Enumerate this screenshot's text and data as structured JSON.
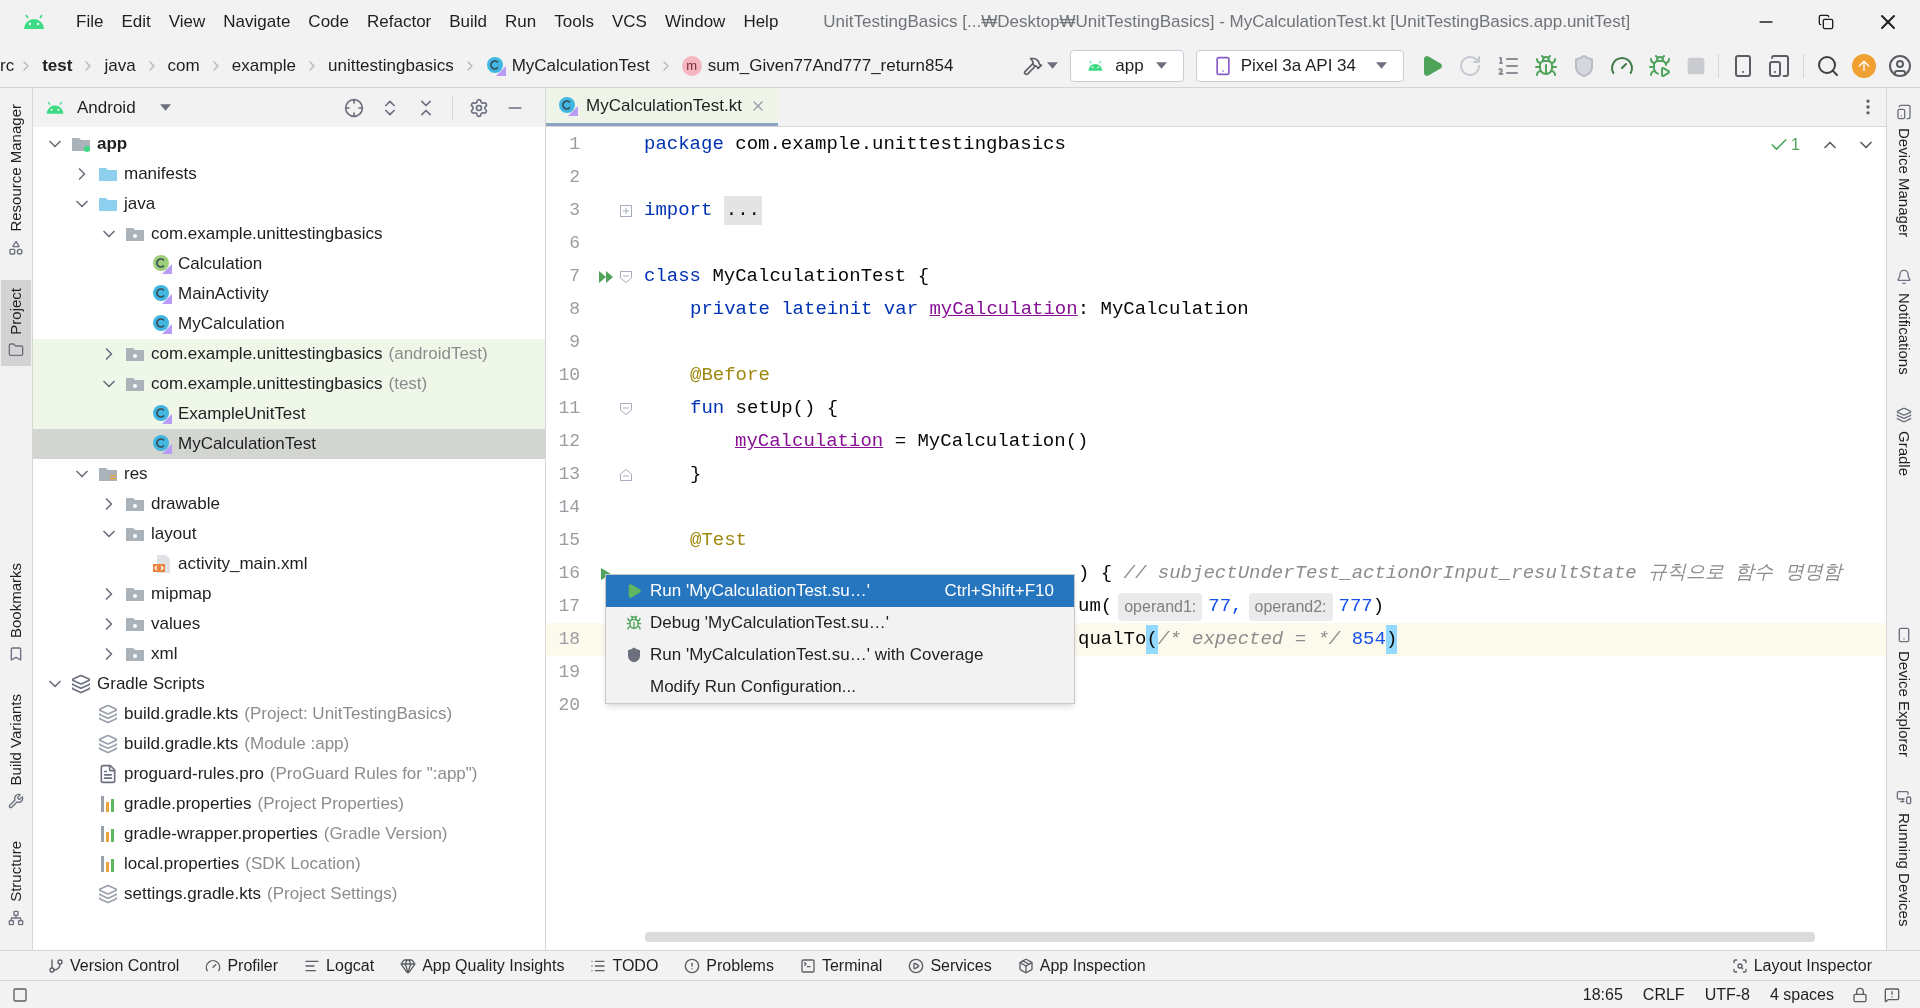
{
  "title_bar": {
    "menu": [
      "File",
      "Edit",
      "View",
      "Navigate",
      "Code",
      "Refactor",
      "Build",
      "Run",
      "Tools",
      "VCS",
      "Window",
      "Help"
    ],
    "title": "UnitTestingBasics [...₩Desktop₩UnitTestingBasics] - MyCalculationTest.kt [UnitTestingBasics.app.unitTest]"
  },
  "navigation_bar": {
    "breadcrumbs": [
      {
        "label": "rc",
        "kind": "plain"
      },
      {
        "label": "test",
        "kind": "bold"
      },
      {
        "label": "java",
        "kind": "plain"
      },
      {
        "label": "com",
        "kind": "plain"
      },
      {
        "label": "example",
        "kind": "plain"
      },
      {
        "label": "unittestingbasics",
        "kind": "plain"
      },
      {
        "label": "MyCalculationTest",
        "kind": "class"
      },
      {
        "label": "sum_Given77And777_return854",
        "kind": "method",
        "badge": "m"
      }
    ],
    "run_configuration": "app",
    "device": "Pixel 3a API 34",
    "actions": [
      {
        "disabled": false
      },
      {
        "disabled": true
      },
      {
        "disabled": false
      },
      {
        "disabled": false
      },
      {
        "disabled": true
      },
      {
        "disabled": false
      },
      {
        "disabled": false
      },
      {
        "disabled": true
      }
    ]
  },
  "left_tool_windows": [
    {
      "label": "Resource Manager",
      "kind": "top",
      "selected": false
    },
    {
      "label": "Project",
      "kind": "top",
      "selected": true
    },
    {
      "label": "Bookmarks",
      "kind": "bottom",
      "selected": false
    },
    {
      "label": "Build Variants",
      "kind": "bottom",
      "selected": false
    },
    {
      "label": "Structure",
      "kind": "bottom",
      "selected": false
    }
  ],
  "project_panel": {
    "view": "Android",
    "tree": [
      {
        "label": "app",
        "kind": "module",
        "expanded": true,
        "selected": false,
        "test_scope": false,
        "children": [
          {
            "label": "manifests",
            "kind": "folder",
            "expanded": false,
            "selected": false,
            "test_scope": false
          },
          {
            "label": "java",
            "kind": "folder",
            "expanded": true,
            "selected": false,
            "test_scope": false,
            "children": [
              {
                "label": "com.example.unittestingbasics",
                "kind": "package",
                "expanded": true,
                "selected": false,
                "test_scope": false,
                "children": [
                  {
                    "label": "Calculation",
                    "kind": "interface",
                    "selected": false,
                    "test_scope": false
                  },
                  {
                    "label": "MainActivity",
                    "kind": "class",
                    "selected": false,
                    "test_scope": false
                  },
                  {
                    "label": "MyCalculation",
                    "kind": "class",
                    "selected": false,
                    "test_scope": false
                  }
                ]
              },
              {
                "label": "com.example.unittestingbasics",
                "detail": "(androidTest)",
                "kind": "package",
                "expanded": false,
                "selected": false,
                "test_scope": true
              },
              {
                "label": "com.example.unittestingbasics",
                "detail": "(test)",
                "kind": "package",
                "expanded": true,
                "selected": false,
                "test_scope": true,
                "children": [
                  {
                    "label": "ExampleUnitTest",
                    "kind": "class",
                    "selected": false,
                    "test_scope": true
                  },
                  {
                    "label": "MyCalculationTest",
                    "kind": "class",
                    "selected": true,
                    "test_scope": true
                  }
                ]
              }
            ]
          },
          {
            "label": "res",
            "kind": "res",
            "expanded": true,
            "selected": false,
            "test_scope": false,
            "children": [
              {
                "label": "drawable",
                "kind": "package",
                "expanded": false,
                "selected": false,
                "test_scope": false
              },
              {
                "label": "layout",
                "kind": "package",
                "expanded": true,
                "selected": false,
                "test_scope": false,
                "children": [
                  {
                    "label": "activity_main.xml",
                    "kind": "xml",
                    "selected": false,
                    "test_scope": false
                  }
                ]
              },
              {
                "label": "mipmap",
                "kind": "package",
                "expanded": false,
                "selected": false,
                "test_scope": false
              },
              {
                "label": "values",
                "kind": "package",
                "expanded": false,
                "selected": false,
                "test_scope": false
              },
              {
                "label": "xml",
                "kind": "package",
                "expanded": false,
                "selected": false,
                "test_scope": false
              }
            ]
          }
        ]
      },
      {
        "label": "Gradle Scripts",
        "kind": "gradle-group",
        "expanded": true,
        "selected": false,
        "test_scope": false,
        "children": [
          {
            "label": "build.gradle.kts",
            "detail": "(Project: UnitTestingBasics)",
            "kind": "gradle",
            "selected": false,
            "test_scope": false
          },
          {
            "label": "build.gradle.kts",
            "detail": "(Module :app)",
            "kind": "gradle",
            "selected": false,
            "test_scope": false
          },
          {
            "label": "proguard-rules.pro",
            "detail": "(ProGuard Rules for \":app\")",
            "kind": "file",
            "selected": false,
            "test_scope": false
          },
          {
            "label": "gradle.properties",
            "detail": "(Project Properties)",
            "kind": "properties",
            "selected": false,
            "test_scope": false
          },
          {
            "label": "gradle-wrapper.properties",
            "detail": "(Gradle Version)",
            "kind": "properties",
            "selected": false,
            "test_scope": false
          },
          {
            "label": "local.properties",
            "detail": "(SDK Location)",
            "kind": "properties",
            "selected": false,
            "test_scope": false
          },
          {
            "label": "settings.gradle.kts",
            "detail": "(Project Settings)",
            "kind": "gradle",
            "selected": false,
            "test_scope": false
          }
        ]
      }
    ]
  },
  "editor": {
    "tabs": [
      {
        "label": "MyCalculationTest.kt",
        "selected": true
      }
    ],
    "problems_count": "1",
    "lines": [
      {
        "number": "1",
        "tokens": [
          {
            "text": "package",
            "kind": "keyword"
          },
          {
            "text": " com.example.unittestingbasics",
            "kind": "plain"
          }
        ]
      },
      {
        "number": "2"
      },
      {
        "number": "3",
        "gutter": [
          {
            "kind": "fold-collapsed"
          }
        ],
        "tokens": [
          {
            "text": "import",
            "kind": "keyword"
          },
          {
            "text": "...",
            "kind": "folded",
            "spaced": true
          }
        ]
      },
      {
        "number": "6"
      },
      {
        "number": "7",
        "gutter": [
          {
            "kind": "run-class"
          },
          {
            "kind": "fold-start"
          }
        ],
        "tokens": [
          {
            "text": "class",
            "kind": "keyword"
          },
          {
            "text": "MyCalculationTest {",
            "kind": "plain",
            "spaced": true
          }
        ]
      },
      {
        "number": "8",
        "kind": "indented",
        "tokens": [
          {
            "text": "private lateinit var",
            "kind": "keyword"
          },
          {
            "text": "myCalculation",
            "kind": "field",
            "spaced": true
          },
          {
            "text": ": MyCalculation",
            "kind": "plain"
          }
        ]
      },
      {
        "number": "9"
      },
      {
        "number": "10",
        "kind": "indented",
        "tokens": [
          {
            "text": "@Before",
            "kind": "annotation"
          }
        ]
      },
      {
        "number": "11",
        "kind": "indented",
        "gutter": [
          {
            "kind": "fold-start"
          }
        ],
        "tokens": [
          {
            "text": "fun",
            "kind": "keyword"
          },
          {
            "text": "setUp() {",
            "kind": "plain",
            "spaced": true
          }
        ]
      },
      {
        "number": "12",
        "kind": "nested",
        "tokens": [
          {
            "text": "myCalculation",
            "kind": "field"
          },
          {
            "text": "= MyCalculation()",
            "kind": "plain",
            "spaced": true
          }
        ]
      },
      {
        "number": "13",
        "kind": "indented",
        "gutter": [
          {
            "kind": "fold-end"
          }
        ],
        "tokens": [
          {
            "text": "}",
            "kind": "plain"
          }
        ]
      },
      {
        "number": "14"
      },
      {
        "number": "15",
        "kind": "indented",
        "tokens": [
          {
            "text": "@Test",
            "kind": "annotation"
          }
        ]
      },
      {
        "number": "16",
        "gutter": [
          {
            "kind": "run-method"
          }
        ],
        "partial": true,
        "tokens": [
          {
            "text": ") {",
            "kind": "plain"
          },
          {
            "text": "// subjectUnderTest_actionOrInput_resultState 규칙으로 함수 명명함",
            "kind": "comment",
            "spaced": true
          }
        ]
      },
      {
        "number": "17",
        "partial": true,
        "tokens": [
          {
            "text": "um(",
            "kind": "plain"
          },
          {
            "text": "operand1:",
            "kind": "hint"
          },
          {
            "text": "77,",
            "kind": "number"
          },
          {
            "text": "operand2:",
            "kind": "hint"
          },
          {
            "text": "777",
            "kind": "number"
          },
          {
            "text": ")",
            "kind": "plain"
          }
        ]
      },
      {
        "number": "18",
        "partial": true,
        "current": true,
        "tokens": [
          {
            "text": "qualTo",
            "kind": "plain"
          },
          {
            "text": "(",
            "kind": "brace"
          },
          {
            "text": "/* expected = */",
            "kind": "comment"
          },
          {
            "text": "854",
            "kind": "number",
            "spaced": true
          },
          {
            "text": ")",
            "kind": "brace"
          }
        ]
      },
      {
        "number": "19"
      },
      {
        "number": "20"
      }
    ],
    "context_menu": [
      {
        "label": "Run 'MyCalculationTest.su…'",
        "shortcut": "Ctrl+Shift+F10",
        "selected": true
      },
      {
        "label": "Debug 'MyCalculationTest.su…'",
        "selected": false
      },
      {
        "label": "Run 'MyCalculationTest.su…' with Coverage",
        "selected": false
      },
      {
        "label": "Modify Run Configuration...",
        "selected": false
      }
    ]
  },
  "right_tool_windows": [
    {
      "label": "Device Manager",
      "kind": "top"
    },
    {
      "label": "Notifications",
      "kind": "top"
    },
    {
      "label": "Gradle",
      "kind": "top"
    },
    {
      "label": "Device Explorer",
      "kind": "bottom"
    },
    {
      "label": "Running Devices",
      "kind": "bottom"
    }
  ],
  "bottom_tool_windows": [
    {
      "label": "Version Control",
      "kind": "left"
    },
    {
      "label": "Profiler",
      "kind": "left"
    },
    {
      "label": "Logcat",
      "kind": "left"
    },
    {
      "label": "App Quality Insights",
      "kind": "left"
    },
    {
      "label": "TODO",
      "kind": "left"
    },
    {
      "label": "Problems",
      "kind": "left"
    },
    {
      "label": "Terminal",
      "kind": "left"
    },
    {
      "label": "Services",
      "kind": "left"
    },
    {
      "label": "App Inspection",
      "kind": "left"
    },
    {
      "label": "Layout Inspector",
      "kind": "right"
    }
  ],
  "status_bar": {
    "items": [
      "18:65",
      "CRLF",
      "UTF-8",
      "4 spaces"
    ]
  }
}
